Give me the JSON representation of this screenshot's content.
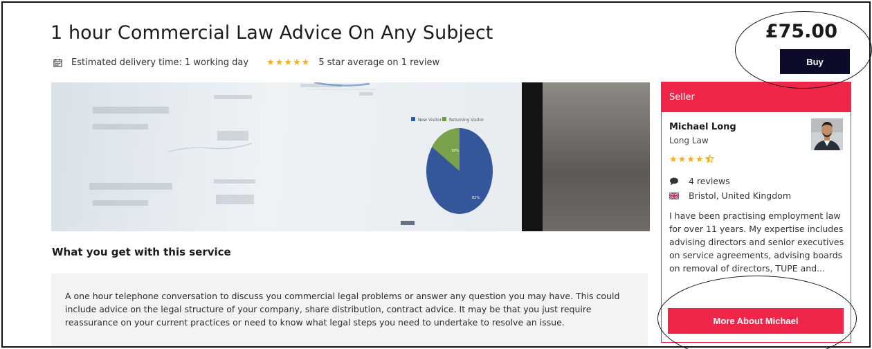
{
  "service": {
    "title": "1 hour Commercial Law Advice On Any Subject",
    "delivery": "Estimated delivery time: 1 working day",
    "rating_stars": "★★★★★",
    "rating_text": "5 star average on 1 review",
    "price": "£75.00",
    "buy_label": "Buy"
  },
  "hero": {
    "legend": [
      "New Visitor",
      "Returning Visitor"
    ],
    "pie_labels": [
      "18%",
      "82%"
    ]
  },
  "details": {
    "section_title": "What you get with this service",
    "description": "A one hour telephone conversation to discuss you commercial legal problems or answer any question you may have.  This could include advice on the legal structure of your company, share distribution, contract advice.  It may be that you just require reassurance on your current practices or need to know what legal steps you need to undertake to resolve an issue."
  },
  "seller": {
    "heading": "Seller",
    "name": "Michael Long",
    "firm": "Long Law",
    "rating": 4.5,
    "rating_stars": "★★★★",
    "reviews": "4 reviews",
    "location": "Bristol, United Kingdom",
    "bio": "I have been practising employment law for over 11 years. My expertise includes advising directors and senior executives on service agreements, advising boards on removal of directors, TUPE and...",
    "more_label": "More About Michael"
  },
  "colors": {
    "accent": "#f0254a",
    "buy_button": "#0c0b2a",
    "star": "#f2b01e"
  },
  "icons": {
    "delivery": "calendar-icon",
    "reviews": "speech-bubble-icon",
    "location": "uk-flag-icon"
  }
}
